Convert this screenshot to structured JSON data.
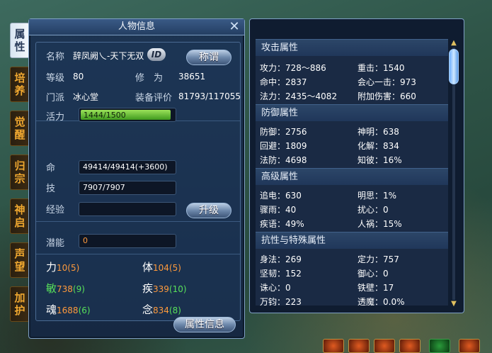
{
  "tabs": [
    {
      "label": "属性",
      "active": true
    },
    {
      "label": "培养",
      "active": false
    },
    {
      "label": "觉醒",
      "active": false
    },
    {
      "label": "归宗",
      "active": false
    },
    {
      "label": "神启",
      "active": false
    },
    {
      "label": "声望",
      "active": false
    },
    {
      "label": "加护",
      "active": false
    }
  ],
  "char_panel": {
    "title": "人物信息",
    "name_label": "名称",
    "name_value": "辞凤阙乀-天下无双",
    "id_badge": "ID",
    "title_button": "称谓",
    "level_label": "等级",
    "level_value": "80",
    "cultivation_label": "修　为",
    "cultivation_value": "38651",
    "sect_label": "门派",
    "sect_value": "冰心堂",
    "equip_label": "装备评价",
    "equip_value": "81793/117055",
    "vitality_label": "活力",
    "vitality_value": "1444/1500",
    "vitality_fraction": 0.963,
    "hp_label": "命",
    "hp_value": "49414/49414(+3600)",
    "mp_label": "技",
    "mp_value": "7907/7907",
    "exp_label": "经验",
    "exp_value": "",
    "upgrade_button": "升级",
    "potential_label": "潜能",
    "potential_value": "0",
    "stats": [
      {
        "label": "力",
        "value": "10",
        "bonus": "(5)",
        "color": "orange"
      },
      {
        "label": "体",
        "value": "104",
        "bonus": "(5)",
        "color": "orange"
      },
      {
        "label": "敏",
        "value": "738",
        "bonus": "(9)",
        "color": "green"
      },
      {
        "label": "疾",
        "value": "339",
        "bonus": "(10)",
        "color": "orange"
      },
      {
        "label": "魂",
        "value": "1688",
        "bonus": "(6)",
        "color": "orange"
      },
      {
        "label": "念",
        "value": "834",
        "bonus": "(8)",
        "color": "orange"
      }
    ],
    "attr_info_button": "属性信息"
  },
  "attr_panel": {
    "sections": [
      {
        "title": "攻击属性",
        "cells": [
          "攻力：728～886",
          "重击：1540",
          "命中：2837",
          "会心一击：973",
          "法力：2435～4082",
          "附加伤害：660"
        ]
      },
      {
        "title": "防御属性",
        "cells": [
          "防御：2756",
          "神明：638",
          "回避：1809",
          "化解：834",
          "法防：4698",
          "知彼：16%"
        ]
      },
      {
        "title": "高级属性",
        "cells": [
          "追电：630",
          "明思：1%",
          "骤雨：40",
          "扰心：0",
          "疾语：49%",
          "人祸：15%"
        ]
      },
      {
        "title": "抗性与特殊属性",
        "cells": [
          "身法：269",
          "定力：757",
          "坚韧：152",
          "御心：0",
          "诛心：0",
          "铁壁：17",
          "万钧：223",
          "透魔：0.0%"
        ]
      }
    ]
  },
  "colors": {
    "orange": "#ff9a3c",
    "green": "#58e05a",
    "panel_bg": "#1a2f4b",
    "tab_text": "#f0a830"
  }
}
